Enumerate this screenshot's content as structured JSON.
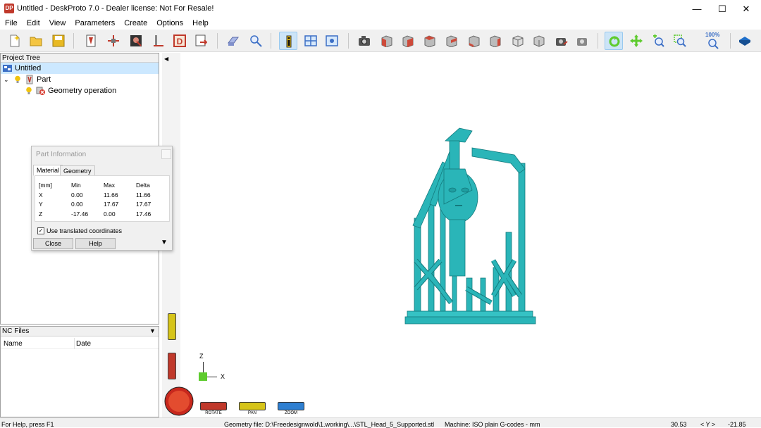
{
  "window": {
    "title": "Untitled - DeskProto 7.0 - Dealer license: Not For Resale!",
    "app_icon_text": "DP",
    "minimize_glyph": "—",
    "maximize_glyph": "☐",
    "close_glyph": "✕"
  },
  "menu": [
    "File",
    "Edit",
    "View",
    "Parameters",
    "Create",
    "Options",
    "Help"
  ],
  "toolbar": {
    "icons": [
      "new-icon",
      "open-icon",
      "save-icon",
      "import-geometry-icon",
      "move-part-icon",
      "bitmap-icon",
      "toolpath-icon",
      "vector-icon",
      "export-icon",
      "simulation-icon",
      "zoom-preview-icon",
      "info-icon",
      "layout-icon",
      "view-settings-icon",
      "camera-icon",
      "view-front-icon",
      "view-back-icon",
      "view-left-icon",
      "view-right-icon",
      "view-top-icon",
      "view-bottom-icon",
      "view-iso-icon",
      "view-iso2-icon",
      "view-reset-icon",
      "view-store-icon",
      "rotate-tool-icon",
      "pan-tool-icon",
      "zoom-tool-icon",
      "zoom-window-icon",
      "zoom-100-icon",
      "help-book-icon"
    ],
    "zoom_label": "100%",
    "colors": {
      "accent_green": "#5ecb2e",
      "active_bg": "#cce4f7"
    }
  },
  "project_tree": {
    "header": "Project Tree",
    "items": [
      {
        "label": "Untitled",
        "icon": "project-icon"
      },
      {
        "label": "Part",
        "icon": "part-icon"
      },
      {
        "label": "Geometry operation",
        "icon": "geometry-error-icon"
      }
    ]
  },
  "part_info": {
    "title": "Part Information",
    "tabs": [
      "Material",
      "Geometry"
    ],
    "columns": [
      "[mm]",
      "Min",
      "Max",
      "Delta"
    ],
    "rows": [
      {
        "axis": "X",
        "min": "0.00",
        "max": "11.66",
        "delta": "11.66"
      },
      {
        "axis": "Y",
        "min": "0.00",
        "max": "17.67",
        "delta": "17.67"
      },
      {
        "axis": "Z",
        "min": "-17.46",
        "max": "0.00",
        "delta": "17.46"
      }
    ],
    "checkbox_label": "Use translated coordinates",
    "checkbox_checked": "✓",
    "close_label": "Close",
    "help_label": "Help"
  },
  "nc_files": {
    "header": "NC Files",
    "columns": [
      "Name",
      "Date"
    ]
  },
  "viewport": {
    "model_color": "#2ab5b8",
    "axis_z": "Z",
    "axis_x": "X",
    "mouse_buttons": [
      "ROTATE",
      "PAN",
      "ZOOM"
    ]
  },
  "statusbar": {
    "help": "For Help, press F1",
    "geometry_file": "Geometry file: D:\\Freedesignwold\\1.working\\...\\STL_Head_5_Supported.stl",
    "machine": "Machine: ISO plain G-codes - mm",
    "coord_x": "30.53",
    "coord_label": "< Y >",
    "coord_y": "-21.85"
  }
}
